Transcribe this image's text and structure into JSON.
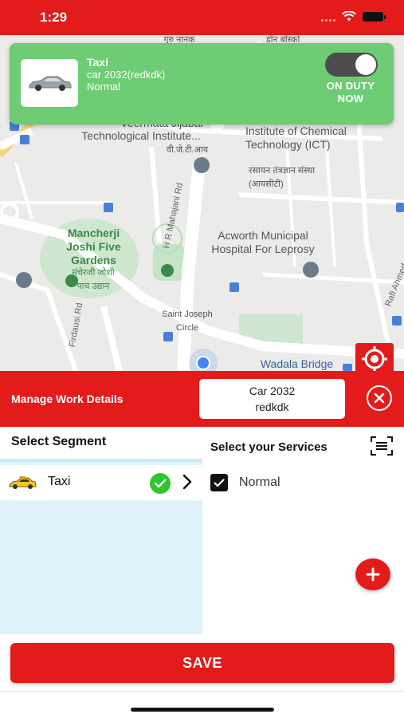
{
  "status_bar": {
    "time": "1:29"
  },
  "map": {
    "labels": {
      "top_left": "Veermata Jijabai",
      "vjti_en": "Technological Institute...",
      "vjti_hi": "वी.जे.टी.आय",
      "ict_en": "Institute of Chemical Technology (ICT)",
      "ict_hi": "रसायन तंत्रज्ञान संस्था (आयसीटी)",
      "top_hi": "गुरु नानक",
      "top_hi_right": "डॉन बॉस्को",
      "hr_mahajani": "H R Mahajani Rd",
      "mancherji_en": "Mancherji Joshi Five Gardens",
      "mancherji_hi": "मंचेरजी जोशी पाच उद्यान",
      "acworth": "Acworth Municipal Hospital For Leprosy",
      "firdausi": "Firdausi Rd",
      "saint_joseph": "Saint Joseph Circle",
      "rafi_ahmed": "Rafi Ahmed",
      "wadala": "Wadala Bridge"
    }
  },
  "duty_card": {
    "segment": "Taxi",
    "vehicle": "car 2032(redkdk)",
    "service": "Normal",
    "status_line1": "ON DUTY",
    "status_line2": "NOW",
    "toggle_on": true
  },
  "manage": {
    "title": "Manage Work Details",
    "vehicle_line1": "Car 2032",
    "vehicle_line2": "redkdk"
  },
  "segments": {
    "header": "Select Segment",
    "items": [
      {
        "label": "Taxi",
        "selected": true
      }
    ]
  },
  "services": {
    "header": "Select your Services",
    "items": [
      {
        "label": "Normal",
        "checked": true
      }
    ]
  },
  "save_label": "SAVE",
  "colors": {
    "brand_red": "#e41b1b",
    "duty_green": "#6dcc74",
    "check_green": "#2ec52e",
    "segment_bg": "#dff3fb"
  }
}
